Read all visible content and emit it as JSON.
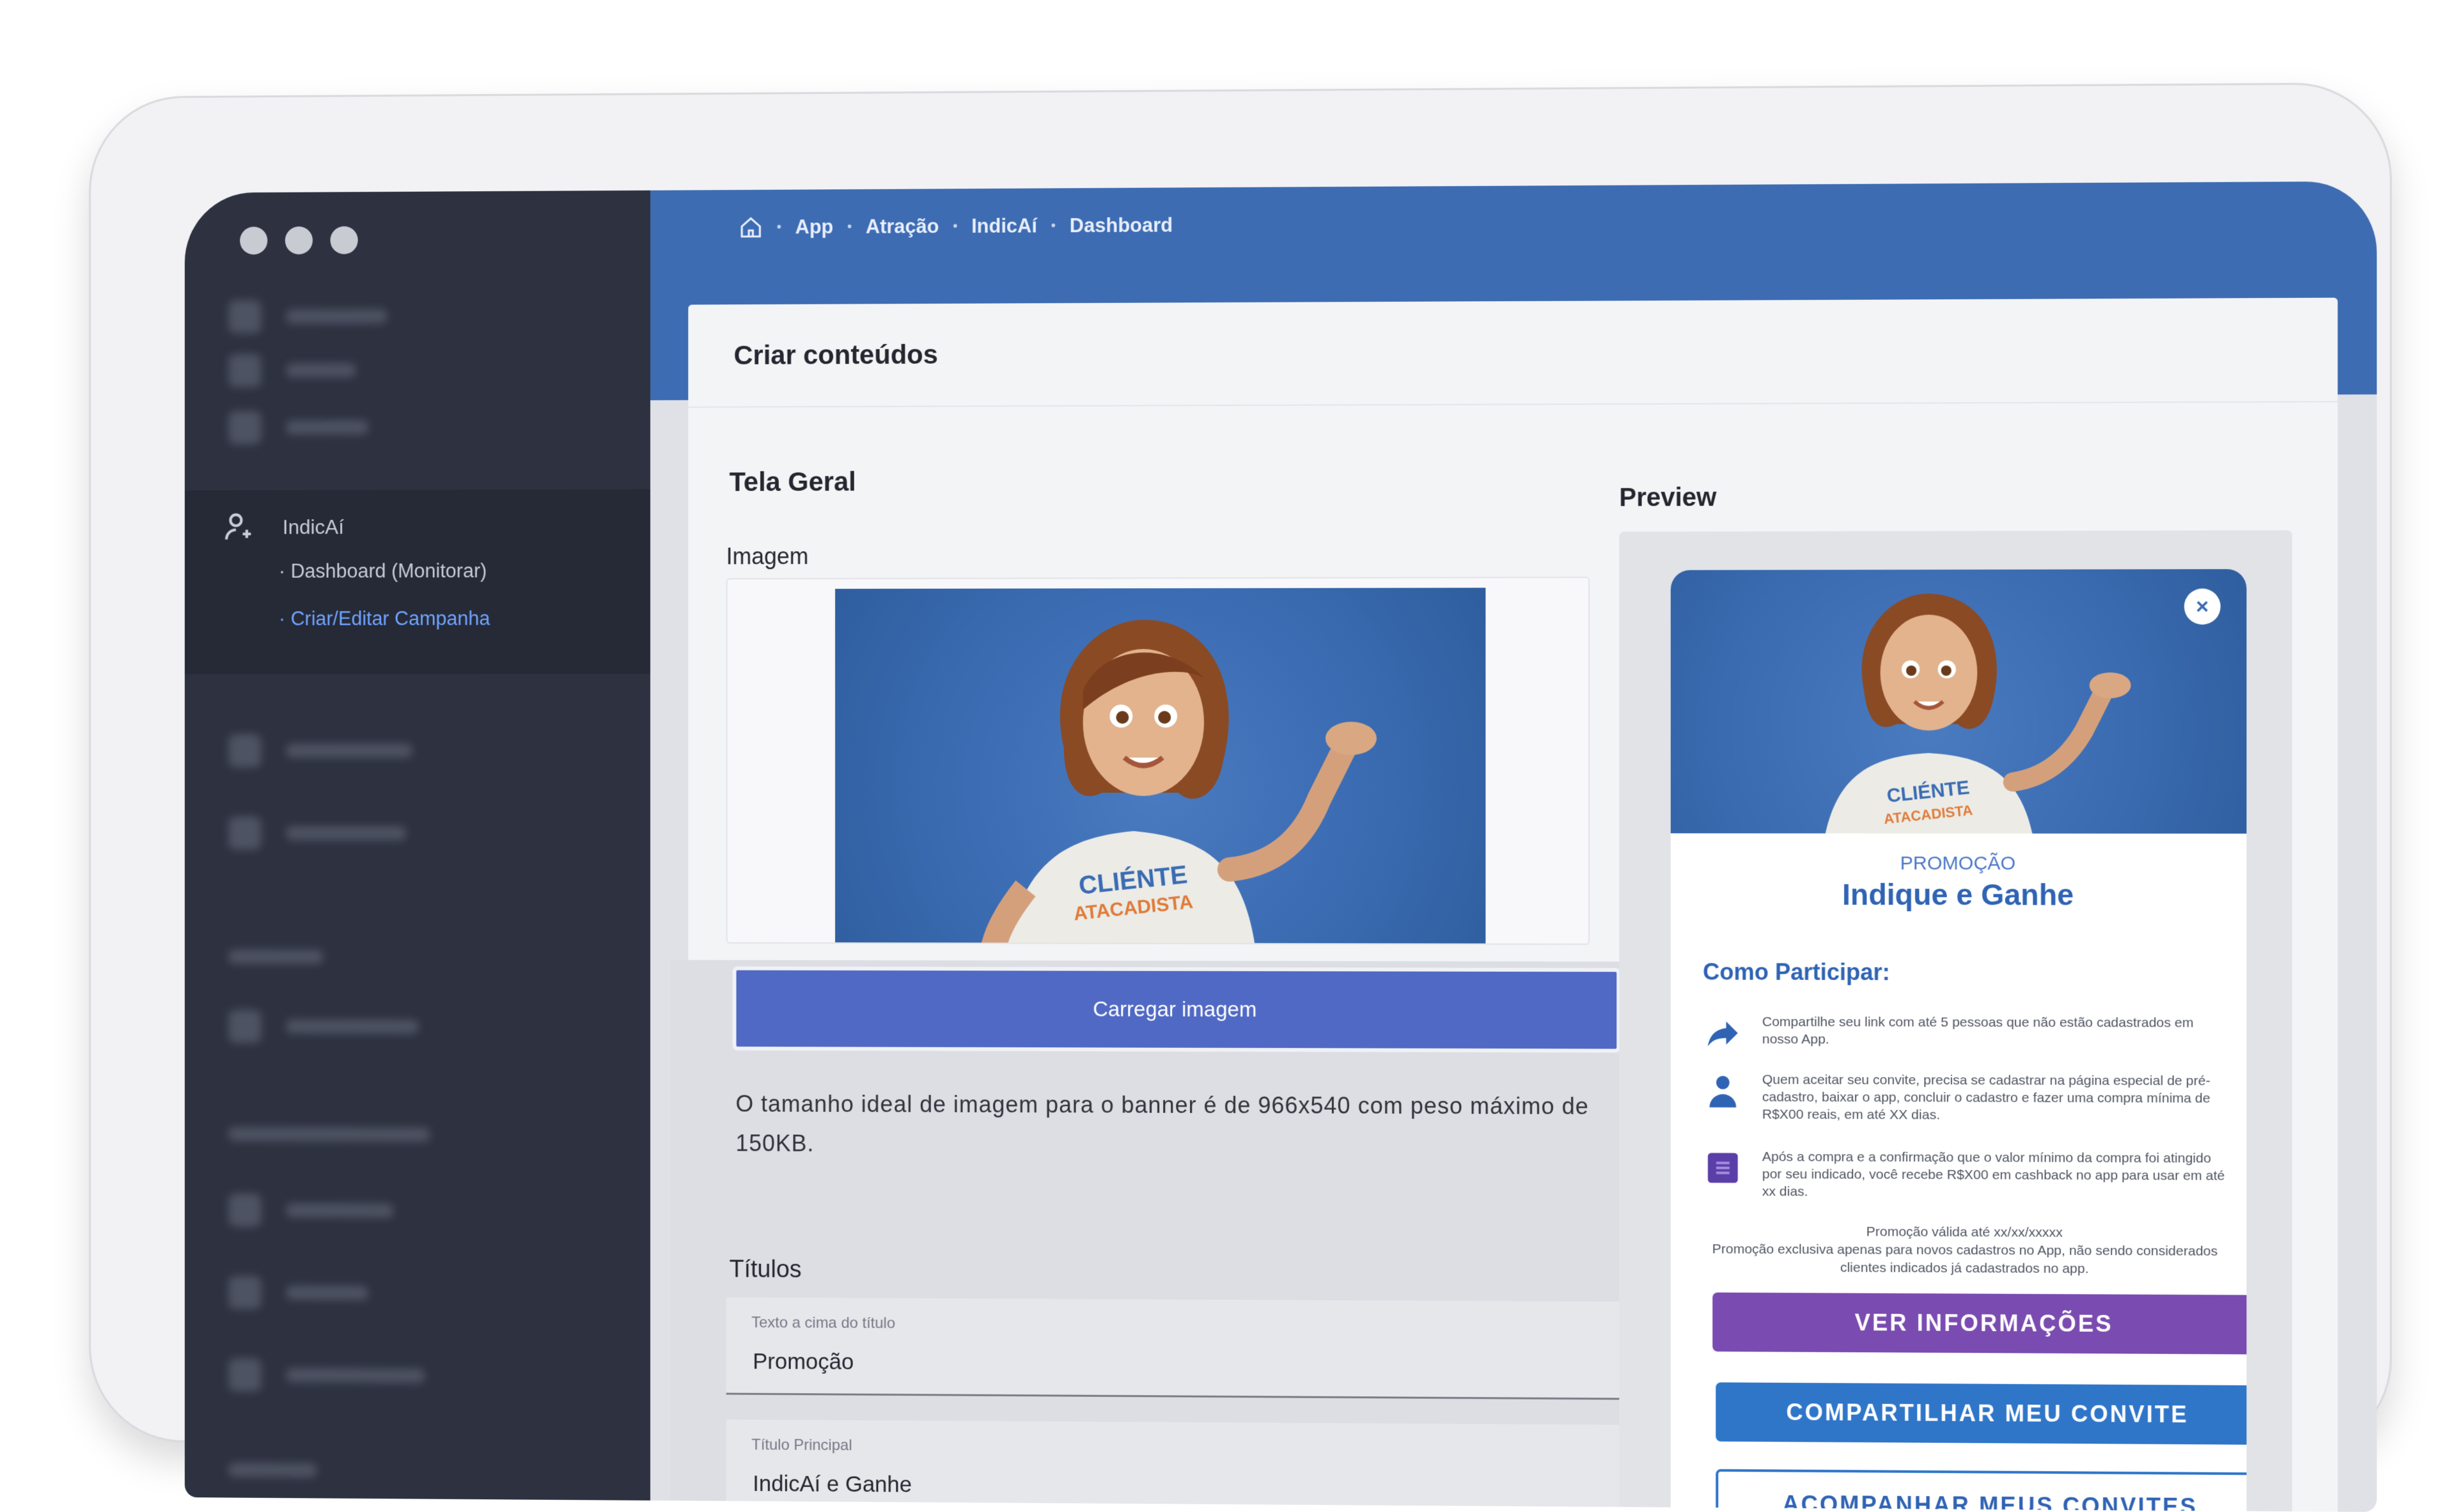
{
  "breadcrumb": [
    "App",
    "Atração",
    "IndicAí",
    "Dashboard"
  ],
  "sidebar": {
    "section_label": "IndicAí",
    "items": [
      {
        "label": "Dashboard (Monitorar)",
        "active": false
      },
      {
        "label": "Criar/Editar Campanha",
        "active": true
      }
    ]
  },
  "card": {
    "title": "Criar conteúdos",
    "left": {
      "section_title": "Tela Geral",
      "image_label": "Imagem",
      "banner_shirt_line1": "CLIÉNTE",
      "banner_shirt_line2": "ATACADISTA",
      "upload_button": "Carregar imagem",
      "hint": "O tamanho ideal de imagem para o banner é de 966x540 com peso máximo de 150KB.",
      "titles_label": "Títulos",
      "fields": [
        {
          "label": "Texto a cima do título",
          "value": "Promoção"
        },
        {
          "label": "Título Principal",
          "value": "IndicAí e Ganhe"
        }
      ],
      "next_label": "Como Participar"
    },
    "right": {
      "preview_title": "Preview",
      "phone": {
        "close": "×",
        "eyebrow": "PROMOÇÃO",
        "title": "Indique e Ganhe",
        "how_title": "Como Participar:",
        "steps": [
          {
            "icon": "share-arrow-icon",
            "text": "Compartilhe seu link com até 5 pessoas que não estão cadastrados em nosso App."
          },
          {
            "icon": "person-icon",
            "text": "Quem aceitar seu convite, precisa se cadastrar na página especial de pré-cadastro, baixar o app, concluir o cadastro e fazer uma compra mínima de R$X00 reais, em até XX dias."
          },
          {
            "icon": "money-icon",
            "text": "Após a compra e a confirmação que o valor mínimo da compra foi atingido por seu indicado, você recebe R$X00 em cashback no app para usar em até xx dias."
          }
        ],
        "note_line1": "Promoção válida até xx/xx/xxxxx",
        "note_line2": "Promoção exclusiva apenas para novos cadastros no App, não sendo considerados clientes indicados já cadastrados no app.",
        "btn_info": "VER INFORMAÇÕES",
        "btn_share": "COMPARTILHAR MEU CONVITE",
        "btn_track": "ACOMPANHAR MEUS CONVITES"
      }
    }
  },
  "colors": {
    "sidebar": "#2d3140",
    "topbar": "#3d6cb3",
    "upload_button": "#5069c4",
    "purple_button": "#7a4bb0",
    "blue_button": "#2f76c9"
  }
}
